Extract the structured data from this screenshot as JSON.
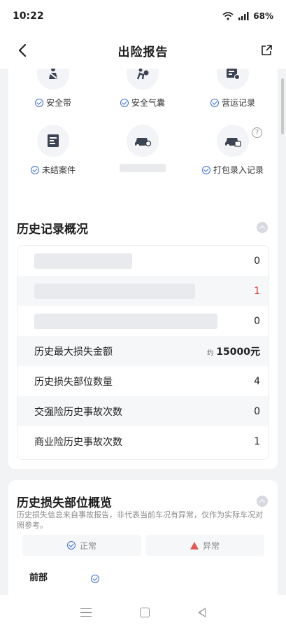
{
  "status": {
    "time": "10:22",
    "battery": "68%"
  },
  "nav": {
    "title": "出险报告"
  },
  "features": [
    {
      "label": "安全带",
      "icon": "seatbelt-icon"
    },
    {
      "label": "安全气囊",
      "icon": "airbag-icon"
    },
    {
      "label": "营运记录",
      "icon": "commercial-record-icon"
    },
    {
      "label": "未结案件",
      "icon": "open-case-icon"
    },
    {
      "label": "",
      "icon": "car-damage-icon"
    },
    {
      "label": "打包录入记录",
      "icon": "package-record-icon"
    }
  ],
  "history": {
    "title": "历史记录概况",
    "rows": [
      {
        "label": "",
        "value": "0"
      },
      {
        "label": "",
        "value": "1"
      },
      {
        "label": "",
        "value": "0"
      },
      {
        "label": "历史最大损失金额",
        "approx": "约",
        "value": "15000元"
      },
      {
        "label": "历史损失部位数量",
        "value": "4"
      },
      {
        "label": "交强险历史事故次数",
        "value": "0"
      },
      {
        "label": "商业险历史事故次数",
        "value": "1"
      }
    ]
  },
  "damage": {
    "title": "历史损失部位概览",
    "subtitle": "历史损失信息来自事故报告，非代表当前车况有异常，仅作为实际车况对照参考。",
    "legend_normal": "正常",
    "legend_abnormal": "异常",
    "part_front": "前部"
  },
  "colors": {
    "accent": "#3b6fd8",
    "alert": "#d93a3a"
  }
}
